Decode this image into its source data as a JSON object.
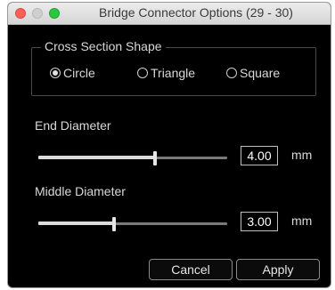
{
  "window": {
    "title": "Bridge Connector Options (29 - 30)"
  },
  "cross_section": {
    "label": "Cross Section Shape",
    "options": [
      {
        "label": "Circle",
        "selected": true
      },
      {
        "label": "Triangle",
        "selected": false
      },
      {
        "label": "Square",
        "selected": false
      }
    ]
  },
  "end_diameter": {
    "label": "End Diameter",
    "value": "4.00",
    "unit": "mm",
    "slider_level": 0.62
  },
  "middle_diameter": {
    "label": "Middle Diameter",
    "value": "3.00",
    "unit": "mm",
    "slider_level": 0.4
  },
  "buttons": {
    "cancel": "Cancel",
    "apply": "Apply"
  }
}
